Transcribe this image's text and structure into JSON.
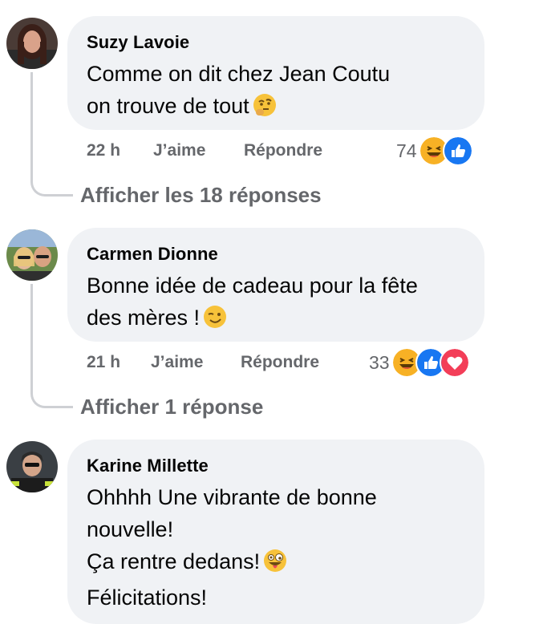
{
  "comments": [
    {
      "author": "Suzy Lavoie",
      "lines": [
        "Comme on dit chez Jean Coutu",
        "on trouve de tout"
      ],
      "emoji": "thinking-face",
      "time": "22 h",
      "like_label": "J’aime",
      "reply_label": "Répondre",
      "reaction_count": "74",
      "reactions": [
        "haha",
        "like"
      ],
      "replies_label": "Afficher les 18 réponses"
    },
    {
      "author": "Carmen Dionne",
      "lines": [
        "Bonne idée de cadeau pour la fête",
        "des mères !"
      ],
      "emoji": "winking-face",
      "time": "21 h",
      "like_label": "J’aime",
      "reply_label": "Répondre",
      "reaction_count": "33",
      "reactions": [
        "haha",
        "like",
        "love"
      ],
      "replies_label": "Afficher 1 réponse"
    },
    {
      "author": "Karine Millette",
      "lines": [
        "Ohhhh Une vibrante de bonne",
        "nouvelle!",
        "Ça rentre dedans!",
        "Félicitations!"
      ],
      "emoji": "zany-face"
    }
  ],
  "colors": {
    "bubble": "#f0f2f5",
    "meta_text": "#65676b",
    "like_blue": "#1877f2",
    "love_red": "#f33e58",
    "emoji_yellow": "#f7b125"
  }
}
